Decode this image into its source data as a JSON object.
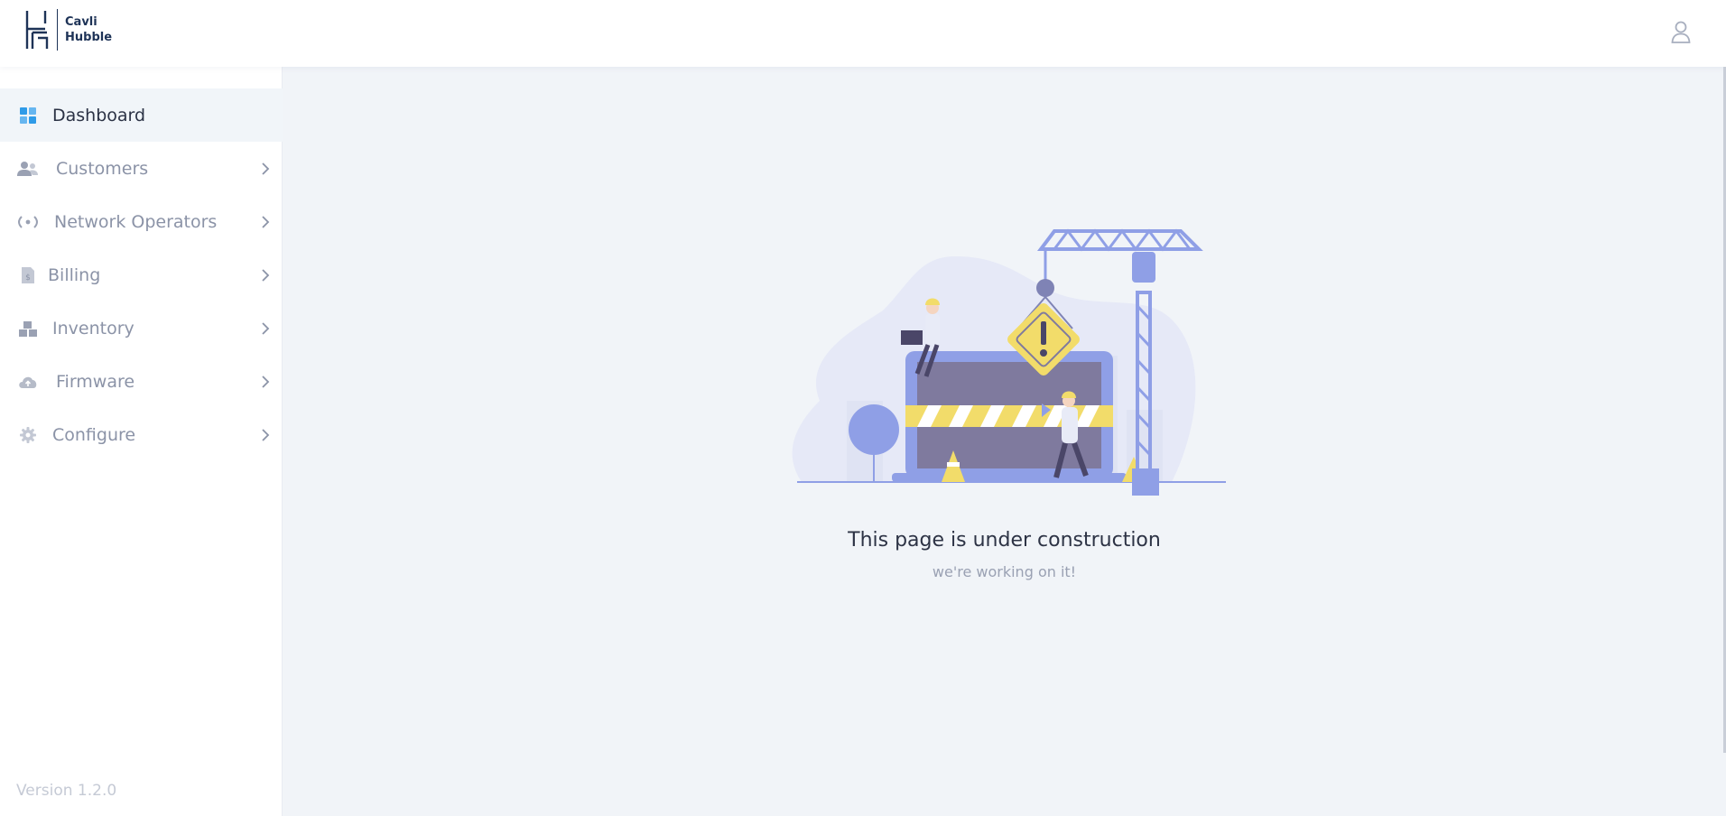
{
  "brand": {
    "line1": "Cavli",
    "line2": "Hubble"
  },
  "header": {
    "user_icon": "user-icon"
  },
  "sidebar": {
    "items": [
      {
        "label": "Dashboard",
        "icon": "dashboard-icon",
        "active": true,
        "has_children": false
      },
      {
        "label": "Customers",
        "icon": "customers-icon",
        "active": false,
        "has_children": true
      },
      {
        "label": "Network Operators",
        "icon": "network-icon",
        "active": false,
        "has_children": true
      },
      {
        "label": "Billing",
        "icon": "billing-icon",
        "active": false,
        "has_children": true
      },
      {
        "label": "Inventory",
        "icon": "inventory-icon",
        "active": false,
        "has_children": true
      },
      {
        "label": "Firmware",
        "icon": "cloud-upload-icon",
        "active": false,
        "has_children": true
      },
      {
        "label": "Configure",
        "icon": "gear-icon",
        "active": false,
        "has_children": true
      }
    ],
    "version": "Version 1.2.0"
  },
  "main": {
    "title": "This page is under construction",
    "subtitle": "we're working on it!"
  },
  "colors": {
    "accent": "#2f9be8",
    "brand": "#1e3357",
    "illustration_primary": "#8f9fe6",
    "illustration_warning": "#f2dc6a"
  }
}
